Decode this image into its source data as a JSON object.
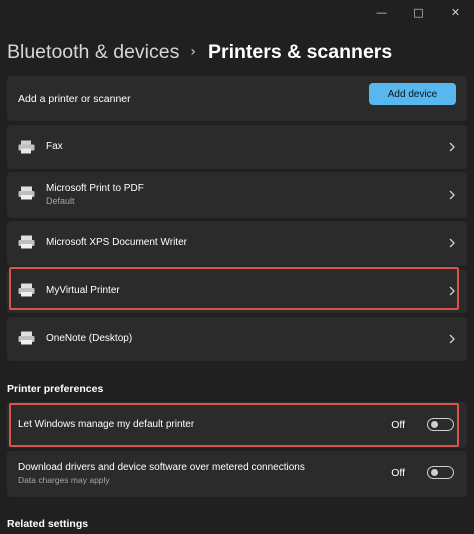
{
  "breadcrumb": {
    "parent": "Bluetooth & devices",
    "separator": "›",
    "current": "Printers & scanners"
  },
  "add_printer": {
    "label": "Add a printer or scanner",
    "button": "Add device"
  },
  "printers": [
    {
      "name": "Fax",
      "subtitle": "",
      "icon": "fax-icon",
      "highlighted": false
    },
    {
      "name": "Microsoft Print to PDF",
      "subtitle": "Default",
      "icon": "printer-icon",
      "highlighted": false
    },
    {
      "name": "Microsoft XPS Document Writer",
      "subtitle": "",
      "icon": "printer-icon",
      "highlighted": false
    },
    {
      "name": "MyVirtual Printer",
      "subtitle": "",
      "icon": "printer-icon",
      "highlighted": true
    },
    {
      "name": "OneNote (Desktop)",
      "subtitle": "",
      "icon": "printer-icon",
      "highlighted": false
    }
  ],
  "preferences": {
    "heading": "Printer preferences",
    "items": [
      {
        "label": "Let Windows manage my default printer",
        "subtitle": "",
        "state": "Off",
        "on": false,
        "highlighted": true
      },
      {
        "label": "Download drivers and device software over metered connections",
        "subtitle": "Data charges may apply",
        "state": "Off",
        "on": false,
        "highlighted": false
      }
    ]
  },
  "related_settings": {
    "heading": "Related settings"
  },
  "colors": {
    "accent": "#57b8f0",
    "highlight": "#d9534f",
    "background": "#202020",
    "card": "#2b2b2b"
  }
}
